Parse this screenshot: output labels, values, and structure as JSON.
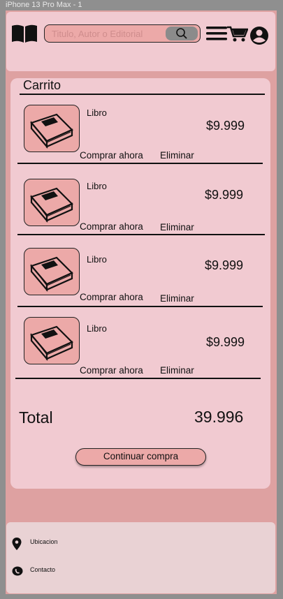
{
  "frame": {
    "label": "iPhone 13 Pro Max - 1"
  },
  "header": {
    "search_placeholder": "Titulo, Autor o Editorial",
    "logo_icon": "book-icon",
    "search_icon": "search-icon",
    "menu_icon": "menu-icon",
    "cart_icon": "cart-icon",
    "user_icon": "user-icon"
  },
  "cart": {
    "title": "Carrito",
    "items": [
      {
        "name": "Libro",
        "price": "$9.999",
        "buy_label": "Comprar ahora",
        "remove_label": "Eliminar"
      },
      {
        "name": "Libro",
        "price": "$9.999",
        "buy_label": "Comprar ahora",
        "remove_label": "Eliminar"
      },
      {
        "name": "Libro",
        "price": "$9.999",
        "buy_label": "Comprar ahora",
        "remove_label": "Eliminar"
      },
      {
        "name": "Libro",
        "price": "$9.999",
        "buy_label": "Comprar ahora",
        "remove_label": "Eliminar"
      }
    ],
    "total_label": "Total",
    "total_value": "39.996",
    "continue_label": "Continuar compra"
  },
  "footer": {
    "location_label": "Ubicacion",
    "contact_label": "Contacto"
  },
  "colors": {
    "background": "#8f8f8f",
    "page": "#dea1a1",
    "panel": "#f1cad1",
    "accent": "#eca9a8",
    "footer": "#e9d2d4"
  }
}
